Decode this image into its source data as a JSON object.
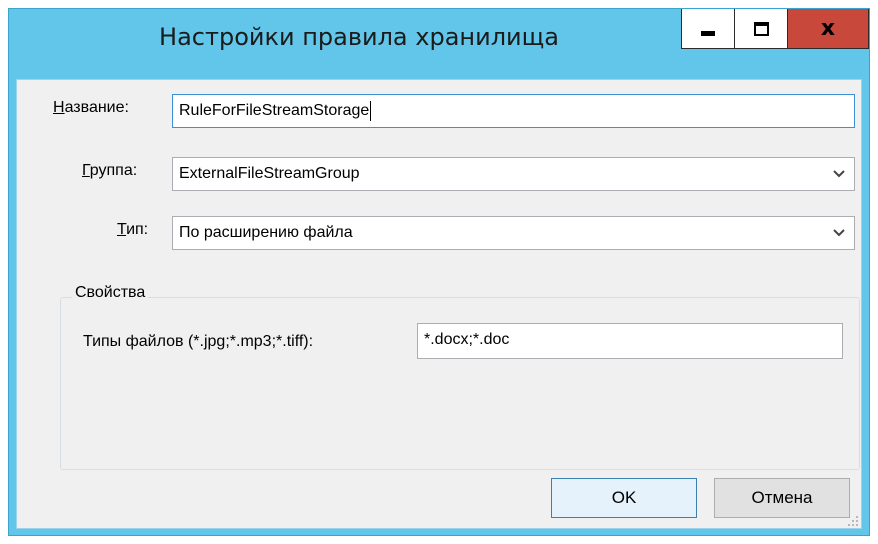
{
  "window": {
    "title": "Настройки правила хранилища",
    "title_bar_color": "#62c6ea",
    "close_button_color": "#c9483c"
  },
  "form": {
    "name": {
      "label_accel": "Н",
      "label_rest": "азвание:",
      "value": "RuleForFileStreamStorage"
    },
    "group": {
      "label_accel": "Г",
      "label_rest": "руппа:",
      "value": "ExternalFileStreamGroup"
    },
    "type": {
      "label_accel": "Т",
      "label_rest": "ип:",
      "value": "По расширению файла"
    }
  },
  "properties": {
    "legend": "Свойства",
    "file_types_label": "Типы файлов (*.jpg;*.mp3;*.tiff):",
    "file_types_value": "*.docx;*.doc"
  },
  "buttons": {
    "ok": "OK",
    "cancel": "Отмена"
  },
  "icons": {
    "minimize": "minimize-icon",
    "maximize": "maximize-icon",
    "close": "close-icon",
    "dropdown": "chevron-down-icon",
    "resize_grip": "resize-grip-icon"
  }
}
